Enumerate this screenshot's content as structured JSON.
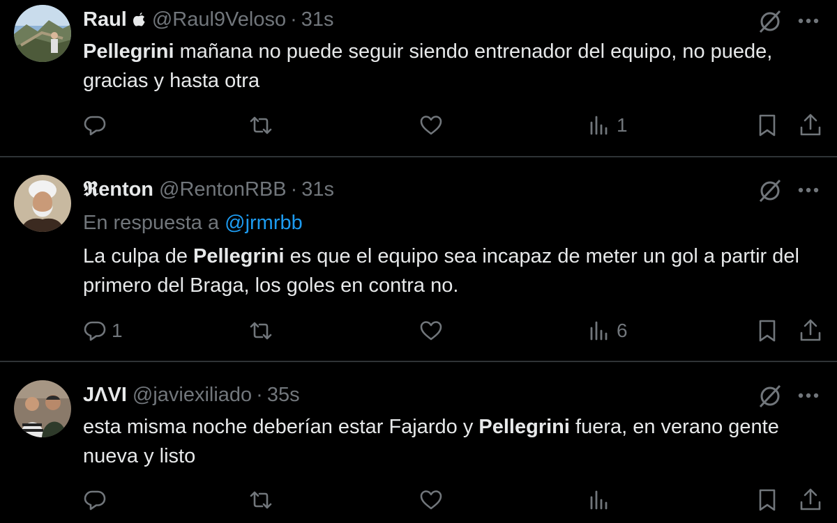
{
  "tweets": [
    {
      "name": "Raul",
      "name_suffix_icon": "apple-logo-icon",
      "handle": "@Raul9Veloso",
      "separator": "·",
      "time": "31s",
      "reply_prefix": "",
      "reply_mention": "",
      "text_parts": [
        "",
        "Pellegrini",
        " mañana no puede seguir siendo entrenador del equipo, no puede, gracias y hasta otra"
      ],
      "actions": {
        "replies": "",
        "retweets": "",
        "likes": "",
        "views": "1"
      }
    },
    {
      "name": "𝕽enton",
      "handle": "@RentonRBB",
      "separator": "·",
      "time": "31s",
      "reply_prefix": "En respuesta a ",
      "reply_mention": "@jrmrbb",
      "text_parts": [
        "La culpa de ",
        "Pellegrini",
        " es que el equipo sea incapaz de meter un gol a partir del primero del Braga, los goles en contra no."
      ],
      "actions": {
        "replies": "1",
        "retweets": "",
        "likes": "",
        "views": "6"
      }
    },
    {
      "name": "JΛVI",
      "handle": "@javiexiliado",
      "separator": "·",
      "time": "35s",
      "reply_prefix": "",
      "reply_mention": "",
      "text_parts": [
        "esta misma noche deberían estar Fajardo y ",
        "Pellegrini",
        " fuera, en verano gente nueva y listo"
      ],
      "actions": {
        "replies": "",
        "retweets": "",
        "likes": "",
        "views": ""
      }
    }
  ],
  "icons": {
    "grok": "grok-icon",
    "more": "more-icon",
    "reply": "reply-icon",
    "retweet": "retweet-icon",
    "like": "heart-icon",
    "views": "views-icon",
    "bookmark": "bookmark-icon",
    "share": "share-icon"
  },
  "colors": {
    "background": "#000000",
    "text": "#e7e9ea",
    "muted": "#71767b",
    "link": "#1d9bf0",
    "divider": "#2f3336"
  }
}
